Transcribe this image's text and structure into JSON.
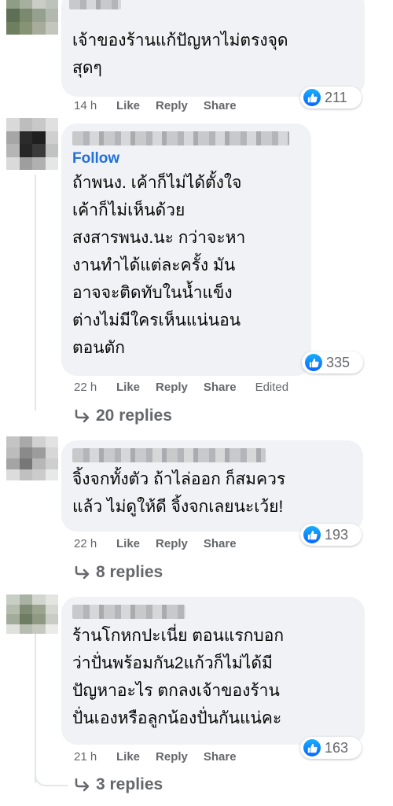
{
  "comments": [
    {
      "text": "เจ้าของร้านแก้ปัญหาไม่ตรงจุด\nสุดๆ",
      "time": "14 h",
      "like": "Like",
      "reply": "Reply",
      "share": "Share",
      "reactions": "211"
    },
    {
      "follow": "Follow",
      "text": "ถ้าพนง. เค้าก็ไม่ได้ตั้งใจ\nเค้าก็ไม่เห็นด้วย\nสงสารพนง.นะ กว่าจะหา\nงานทำได้แต่ละครั้ง มัน\nอาจจะติดทับในน้ำแข็ง\nต่างไม่มีใครเห็นแน่นอน\nตอนตัก",
      "time": "22 h",
      "like": "Like",
      "reply": "Reply",
      "share": "Share",
      "edited": "Edited",
      "reactions": "335",
      "replies": "20 replies"
    },
    {
      "text": "จิ้งจกทั้งตัว ถ้าไล่ออก ก็สมควร\nแล้ว ไม่ดูให้ดี จิ้งจกเลยนะเว้ย!",
      "time": "22 h",
      "like": "Like",
      "reply": "Reply",
      "share": "Share",
      "reactions": "193",
      "replies": "8 replies"
    },
    {
      "text": "ร้านโกหกปะเนี่ย ตอนแรกบอก\nว่าปั่นพร้อมกัน2แก้วก็ไม่ได้มี\nปัญหาอะไร ตกลงเจ้าของร้าน\nปั่นเองหรือลูกน้องปั่นกันแน่คะ",
      "time": "21 h",
      "like": "Like",
      "reply": "Reply",
      "share": "Share",
      "reactions": "163",
      "replies": "3 replies"
    }
  ],
  "colors": {
    "like_blue": "#0866ff",
    "follow_blue": "#216fdb",
    "bubble_bg": "#f0f2f5",
    "meta_gray": "#65676b"
  },
  "icons": [
    "thumbs-up-icon",
    "reply-arrow-icon"
  ]
}
